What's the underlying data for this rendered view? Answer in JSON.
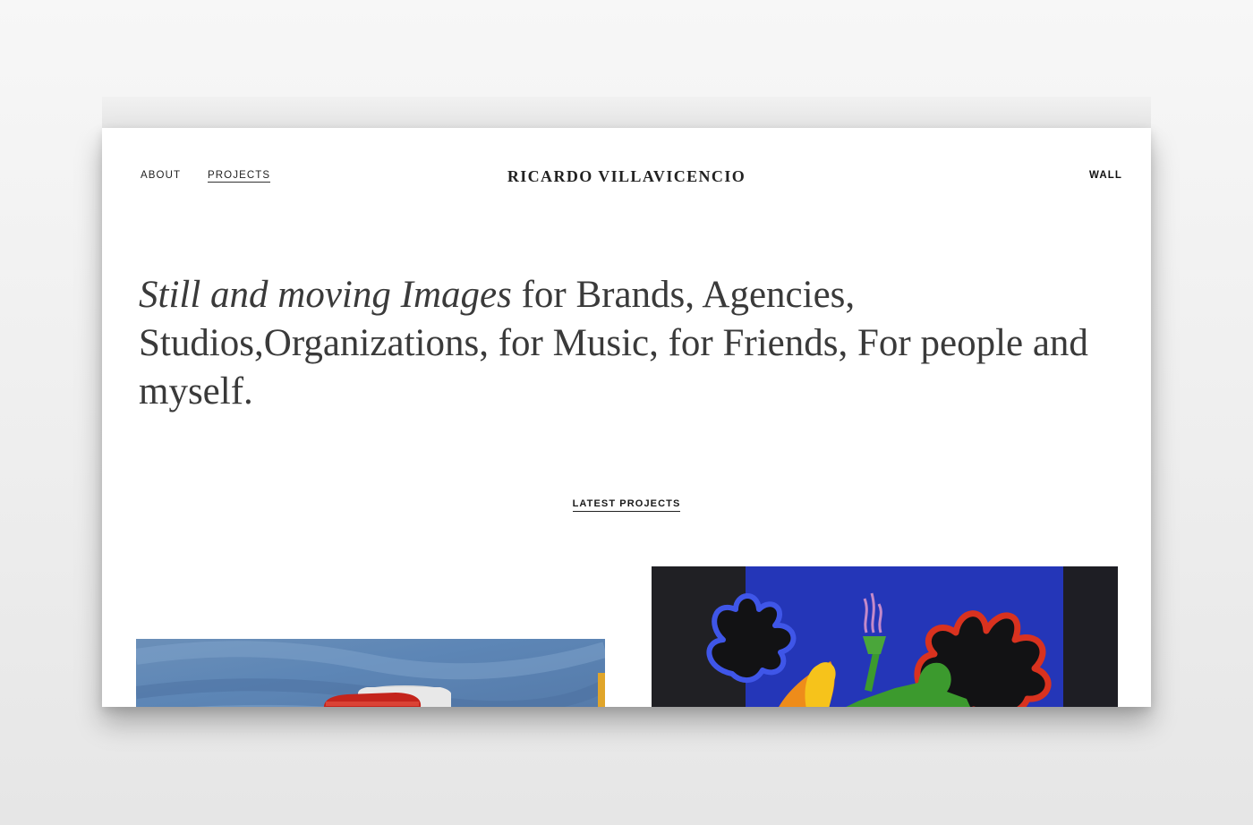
{
  "nav": {
    "about": "ABOUT",
    "projects": "PROJECTS",
    "wall": "WALL"
  },
  "site": {
    "title": "RICARDO VILLAVICENCIO"
  },
  "hero": {
    "italic": "Still and moving Images",
    "rest": " for Brands, Agencies, Studios,Organizations, for Music, for Friends, For people and myself."
  },
  "latest": {
    "label": "LATEST PROJECTS"
  },
  "projects": [
    {
      "thumbnail": "project-thumbnail-painted-cup"
    },
    {
      "thumbnail": "project-thumbnail-paper-cutout"
    }
  ],
  "colors": {
    "page_background": "#efefef",
    "text": "#3a3a3a",
    "accent_blue": "#3b4fd6",
    "accent_red": "#d9321f",
    "accent_green": "#3c9a2e",
    "accent_yellow": "#f5c21b"
  }
}
